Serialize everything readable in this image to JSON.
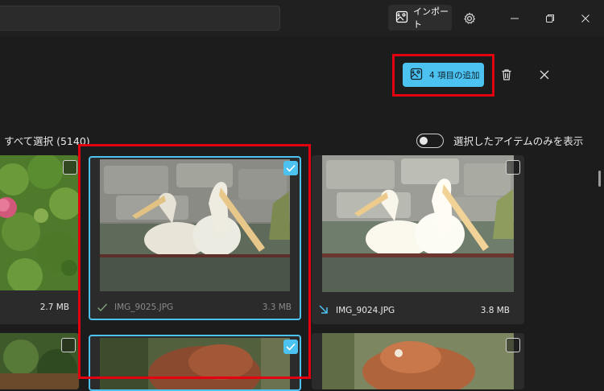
{
  "titlebar": {
    "import_label": "インポート"
  },
  "toolbar": {
    "add_label": "4 項目の追加"
  },
  "selection": {
    "select_all_label": "すべて選択 (5140)",
    "toggle_label": "選択したアイテムのみを表示",
    "toggle_on": false
  },
  "photos": [
    {
      "name": "",
      "size": "2.7 MB",
      "selected": false,
      "status": "none"
    },
    {
      "name": "IMG_9025.JPG",
      "size": "3.3 MB",
      "selected": true,
      "status": "imported-check"
    },
    {
      "name": "IMG_9024.JPG",
      "size": "3.8 MB",
      "selected": false,
      "status": "import-arrow"
    },
    {
      "name": "",
      "size": "",
      "selected": false,
      "status": "none"
    },
    {
      "name": "",
      "size": "",
      "selected": true,
      "status": "none"
    },
    {
      "name": "",
      "size": "",
      "selected": false,
      "status": "none"
    }
  ],
  "colors": {
    "accent": "#4cc2f1",
    "highlight_box": "#e3000f",
    "background": "#1c1c1c"
  }
}
